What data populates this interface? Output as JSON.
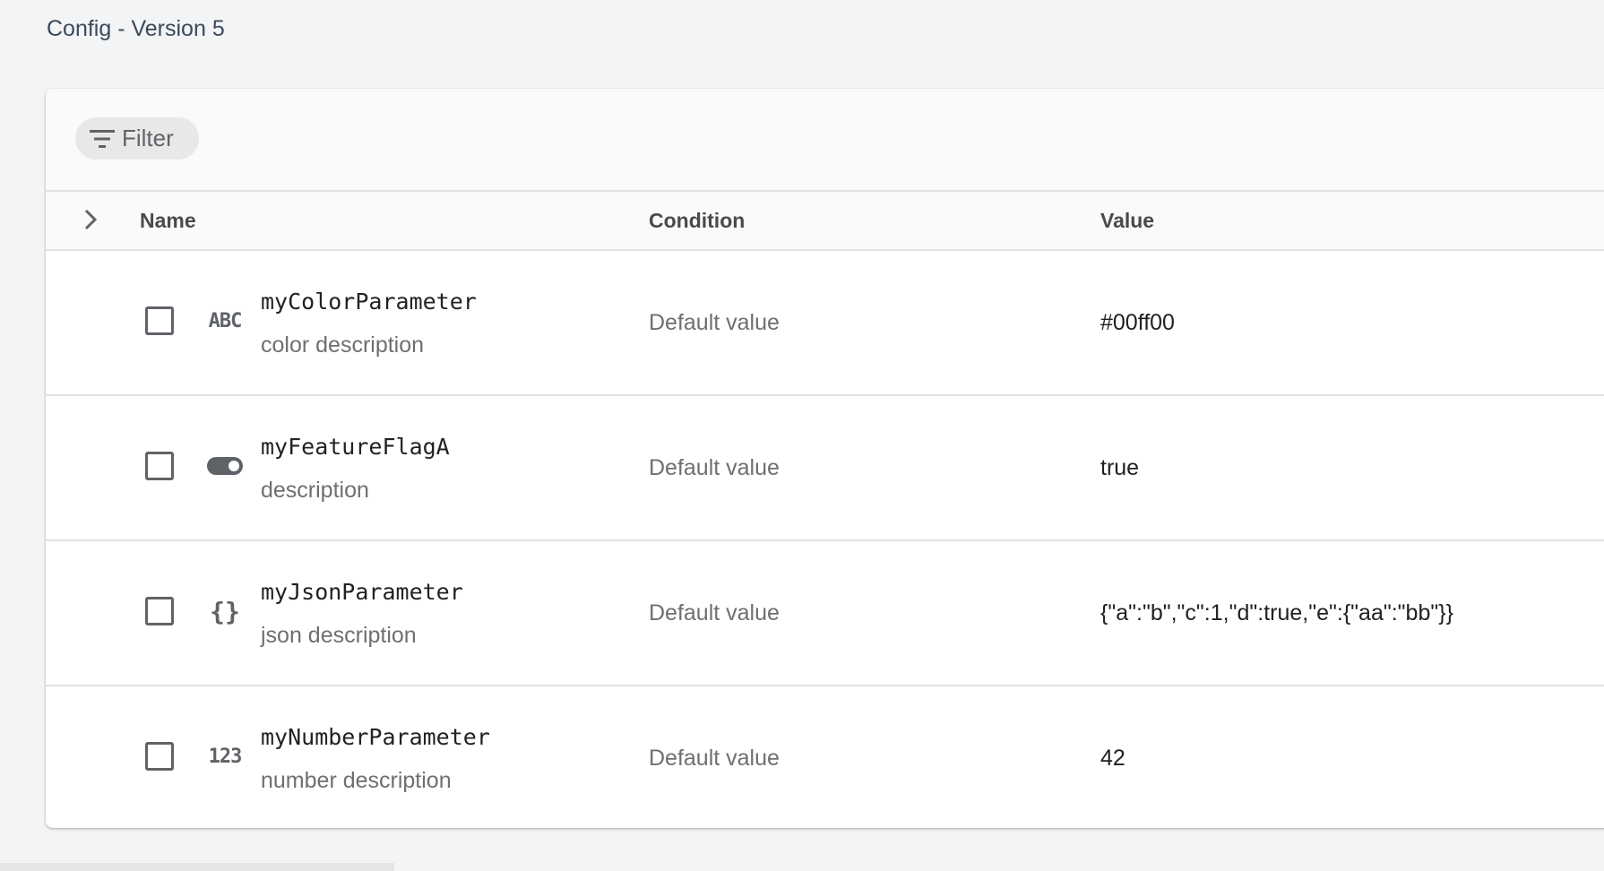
{
  "page": {
    "title": "Config - Version 5"
  },
  "toolbar": {
    "filter_label": "Filter",
    "filter_icon": "filter-list-icon"
  },
  "table": {
    "headers": {
      "name": "Name",
      "condition": "Condition",
      "value": "Value"
    },
    "rows": [
      {
        "name": "myColorParameter",
        "description": "color description",
        "condition": "Default value",
        "value": "#00ff00",
        "type_icon": "string-icon",
        "type_text": "ABC"
      },
      {
        "name": "myFeatureFlagA",
        "description": "description",
        "condition": "Default value",
        "value": "true",
        "type_icon": "boolean-toggle-icon",
        "type_text": ""
      },
      {
        "name": "myJsonParameter",
        "description": "json description",
        "condition": "Default value",
        "value": "{\"a\":\"b\",\"c\":1,\"d\":true,\"e\":{\"aa\":\"bb\"}}",
        "type_icon": "json-icon",
        "type_text": "{}"
      },
      {
        "name": "myNumberParameter",
        "description": "number description",
        "condition": "Default value",
        "value": "42",
        "type_icon": "number-icon",
        "type_text": "123"
      }
    ]
  },
  "colors": {
    "background": "#f3f4f6",
    "card": "#ffffff",
    "header_bg": "#fafafa",
    "chip_bg": "#e8e8e8",
    "icon": "#5f6368",
    "title": "#3b4a5c"
  }
}
